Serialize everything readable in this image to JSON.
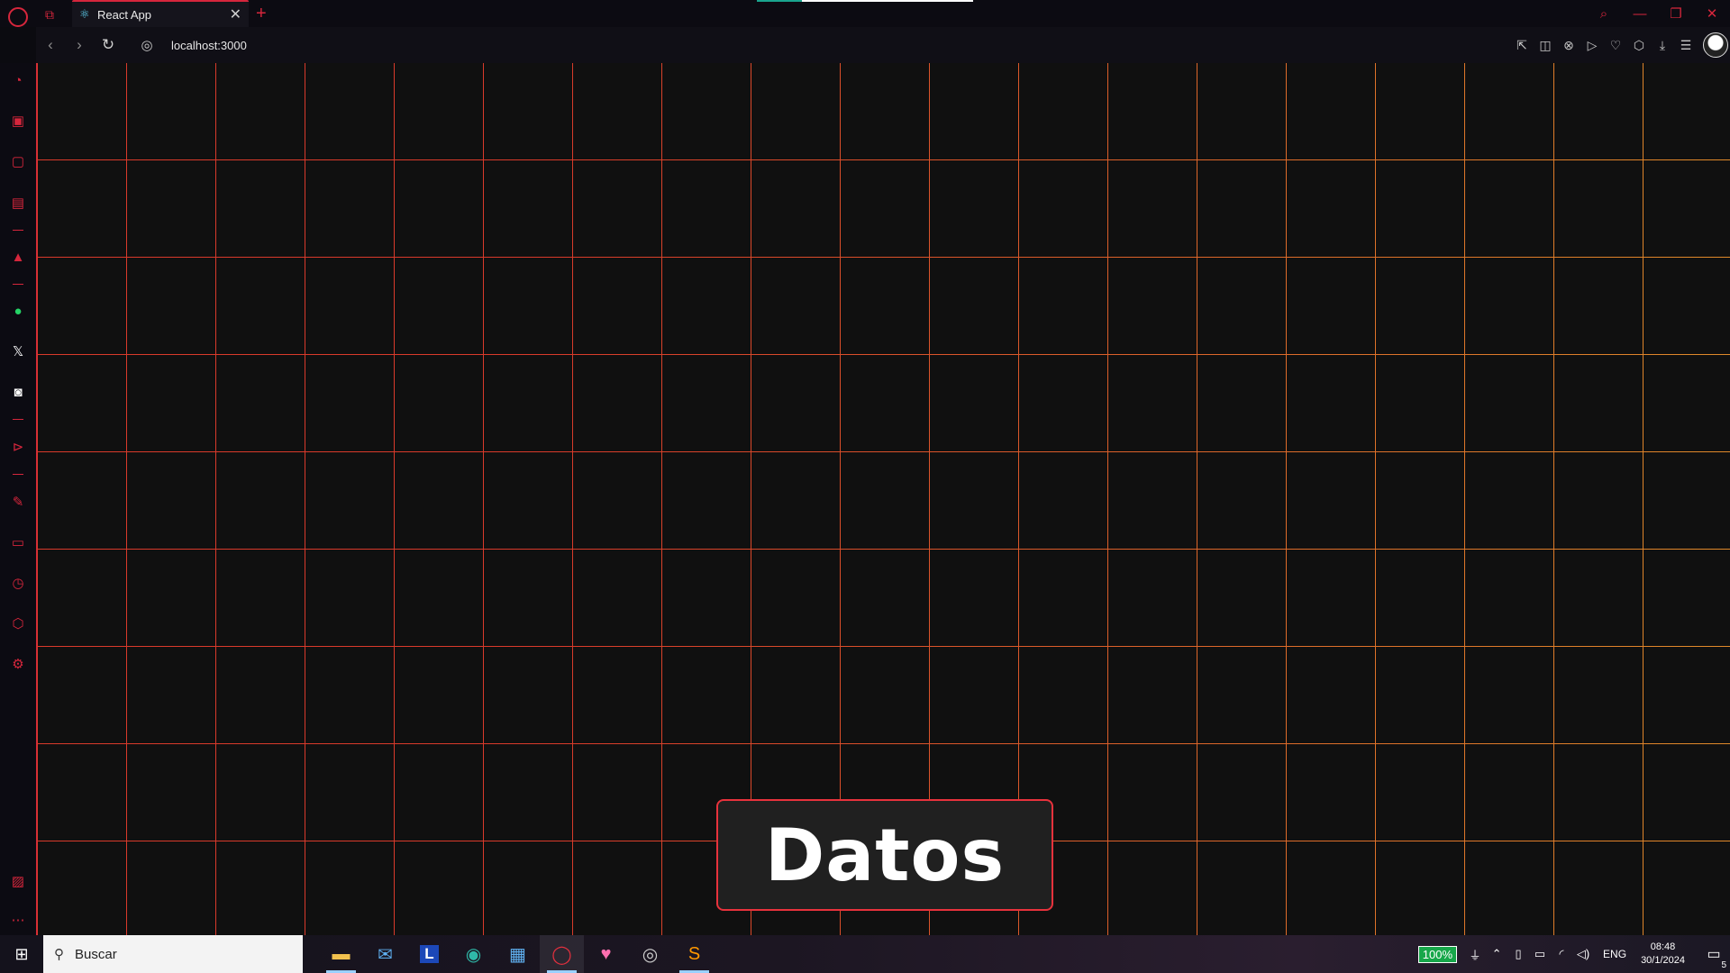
{
  "browser": {
    "tab_title": "React App",
    "new_tab_symbol": "+",
    "url": "localhost:3000",
    "window_controls": {
      "search": "⌕",
      "minimize": "—",
      "restore": "❐",
      "close": "✕"
    }
  },
  "sidebar": {
    "icons": [
      "speed-dial-icon",
      "bag-icon",
      "twitch-icon",
      "clipboard-icon",
      "aria-icon",
      "whatsapp-icon",
      "x-icon",
      "discord-icon",
      "player-icon",
      "pinboard-icon",
      "tabs-icon",
      "history-icon",
      "cube-icon",
      "settings-icon",
      "gallery-icon",
      "more-icon"
    ]
  },
  "page": {
    "button_label": "Datos"
  },
  "taskbar": {
    "search_placeholder": "Buscar",
    "battery": "100%",
    "language": "ENG",
    "time": "08:48",
    "date": "30/1/2024",
    "notification_count": "5"
  },
  "colors": {
    "accent": "#d6263c",
    "grid_red": "#d93a2b",
    "grid_orange": "#e08a2a",
    "page_bg": "#101010"
  }
}
